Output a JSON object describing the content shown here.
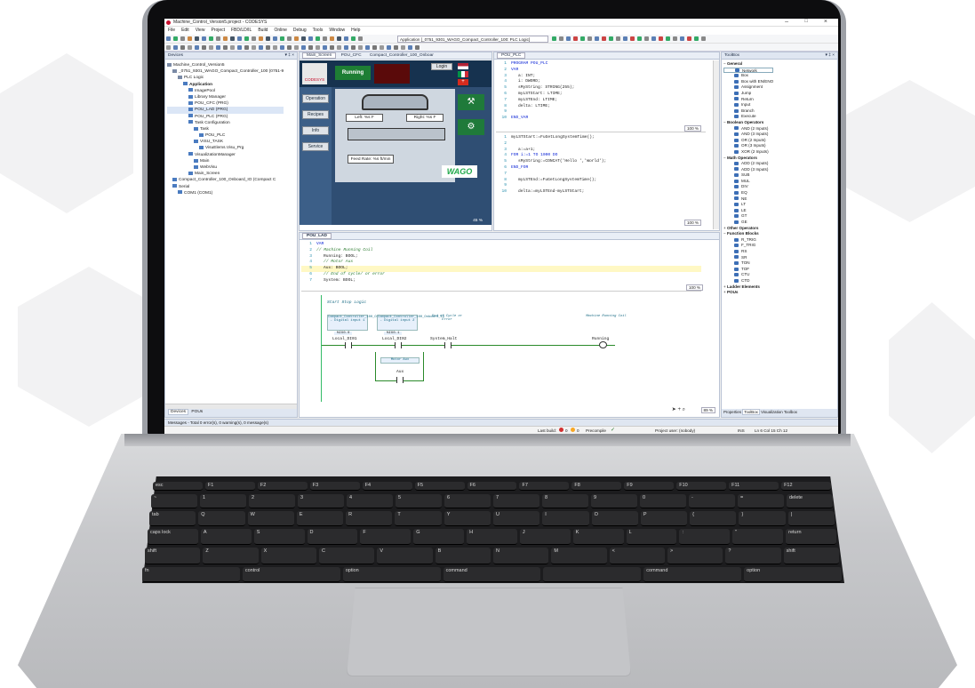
{
  "window": {
    "title": "Machine_Control_Version5.project - CODESYS"
  },
  "menu": [
    "File",
    "Edit",
    "View",
    "Project",
    "FBD/LD/IL",
    "Build",
    "Online",
    "Debug",
    "Tools",
    "Window",
    "Help"
  ],
  "toolbar": {
    "application_combo": "Application [_0751_9301_WAGO_Compact_Controller_100: PLC Logic]"
  },
  "devices": {
    "title": "Devices",
    "items": [
      "Machine_Control_Version5",
      "_0751_9301_WAGO_Compact_Controller_100 (0751-9",
      "PLC Logic",
      "Application",
      "ImagePool",
      "Library Manager",
      "POU_CFC (PRG)",
      "POU_LAD (PRG)",
      "POU_PLC (PRG)",
      "Task Configuration",
      "Task",
      "POU_PLC",
      "VISU_TASK",
      "VisuElems.Visu_Prg",
      "VisualizationManager",
      "Main",
      "WebVisu",
      "Main_Screen",
      "Compact_Controller_100_Onboard_IO (Compact C",
      "Serial",
      "COM1 (COM1)"
    ],
    "tab_devices": "Devices",
    "tab_pous": "POUs"
  },
  "editor_tabs": {
    "left": [
      "Main_Screen",
      "POU_CFC",
      "Compact_Controller_100_Onboar"
    ],
    "right": [
      "POU_PLC"
    ],
    "lad": [
      "POU_LAD"
    ]
  },
  "hmi": {
    "logo": "CODESYS",
    "status": "Running",
    "login": "Login",
    "side_buttons": [
      "Operation",
      "Recipes",
      "Info",
      "Service"
    ],
    "left_temp": "Left: %s F",
    "right_temp": "Right: %s F",
    "feed_rate": "Feed Rate: %s ft/min",
    "brand": "WAGO",
    "zoom": "45 %"
  },
  "pou_plc": {
    "decl": [
      "PROGRAM POU_PLC",
      "VAR",
      "a: INT;",
      "i: DWORD;",
      "sMyString: STRING(255);",
      "myLSTStart: LTIME;",
      "myLSTEnd: LTIME;",
      "delta: LTIME;",
      "",
      "END_VAR"
    ],
    "decl_zoom": "100 %",
    "body": [
      "myLSTStart:=FuGetLongSystemTime();",
      "",
      "a:=a+1;",
      "FOR i:=1 TO 1000 DO",
      "sMyString:=CONCAT('Hello ','World');",
      "END_FOR",
      "",
      "myLSTEnd:=FuGetLongSystemTime();",
      "",
      "delta:=myLSTEnd-myLSTStart;"
    ],
    "body_zoom": "100 %"
  },
  "pou_lad": {
    "decl": [
      "VAR",
      "// Machine Running Coil",
      "Running: BOOL;",
      "// Motor Aux",
      "Aux: BOOL;",
      "// End of cycle/ or error",
      "System: BOOL;"
    ],
    "decl_zoom": "100 %",
    "rung_comment": "Start Stop Logic",
    "contacts": [
      {
        "desc": "Compact_Controller_100_Onboard_IO - Digital input 1",
        "addr": "%IX0.0",
        "var": "Local_DI01"
      },
      {
        "desc": "Compact_Controller_100_Onboard_IO - Digital input 2",
        "addr": "%IX0.1",
        "var": "Local_DI02"
      },
      {
        "desc": "End of Cycle or Error",
        "addr": "",
        "var": "System_Halt"
      }
    ],
    "coil": {
      "desc": "Machine Running Coil",
      "var": "Running"
    },
    "aux": {
      "desc": "Motor Aux",
      "var": "Aux"
    },
    "zoom": "89 %"
  },
  "toolbox": {
    "title": "ToolBox",
    "groups": [
      {
        "name": "General",
        "items": [
          "Network",
          "Box",
          "Box with EN/ENO",
          "Assignment",
          "Jump",
          "Return",
          "Input",
          "Branch",
          "Execute"
        ]
      },
      {
        "name": "Boolean Operators",
        "items": [
          "AND (2 Inputs)",
          "AND (3 Inputs)",
          "OR (2 Inputs)",
          "OR (3 Inputs)",
          "XOR (2 Inputs)"
        ]
      },
      {
        "name": "Math Operators",
        "items": [
          "ADD (2 Inputs)",
          "ADD (3 Inputs)",
          "SUB",
          "MUL",
          "DIV",
          "EQ",
          "NE",
          "LT",
          "LE",
          "GT",
          "GE"
        ]
      },
      {
        "name": "Other Operators",
        "items": []
      },
      {
        "name": "Function Blocks",
        "items": [
          "R_TRIG",
          "F_TRIG",
          "RS",
          "SR",
          "TON",
          "TOF",
          "CTU",
          "CTD"
        ]
      },
      {
        "name": "Ladder Elements",
        "items": []
      },
      {
        "name": "POUs",
        "items": []
      }
    ],
    "bottom_tabs": [
      "Properties",
      "ToolBox",
      "Visualization Toolbox"
    ]
  },
  "messages": "Messages - Total 0 error(s), 0 warning(s), 0 message(s)",
  "statusbar": {
    "last_build": "Last build:",
    "errors": "0",
    "warnings": "0",
    "precompile": "Precompile",
    "project_user": "Project user: (nobody)",
    "mode": "INS",
    "position": "Ln 6   Col 15   Ch 12"
  },
  "keyboard": {
    "row0": [
      "esc",
      "F1",
      "F2",
      "F3",
      "F4",
      "F5",
      "F6",
      "F7",
      "F8",
      "F9",
      "F10",
      "F11",
      "F12"
    ],
    "row1": [
      "~",
      "1",
      "2",
      "3",
      "4",
      "5",
      "6",
      "7",
      "8",
      "9",
      "0",
      "-",
      "=",
      "delete"
    ],
    "row2": [
      "tab",
      "Q",
      "W",
      "E",
      "R",
      "T",
      "Y",
      "U",
      "I",
      "O",
      "P",
      "{",
      "}",
      "|"
    ],
    "row3": [
      "caps lock",
      "A",
      "S",
      "D",
      "F",
      "G",
      "H",
      "J",
      "K",
      "L",
      ":",
      "\"",
      "return"
    ],
    "row4": [
      "shift",
      "Z",
      "X",
      "C",
      "V",
      "B",
      "N",
      "M",
      "<",
      ">",
      "?",
      "shift"
    ],
    "row5": [
      "fn",
      "control",
      "option",
      "command",
      "",
      "command",
      "option"
    ]
  }
}
